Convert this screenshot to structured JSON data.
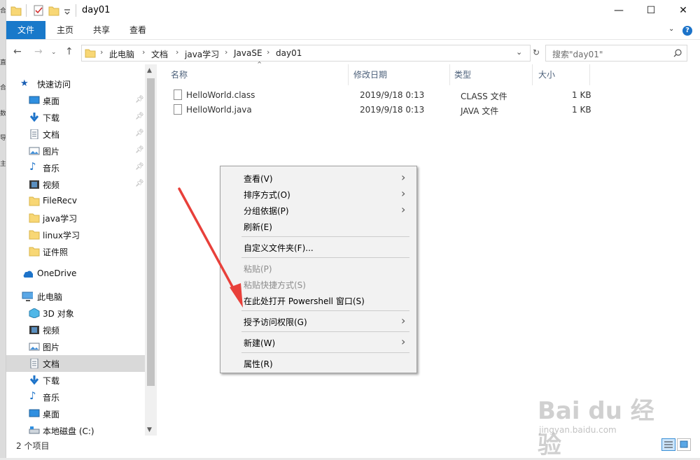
{
  "window": {
    "title": "day01",
    "controls": {
      "minimize": "—",
      "maximize": "☐",
      "close": "✕"
    }
  },
  "ribbon": {
    "tabs": [
      {
        "label": "文件",
        "active": true
      },
      {
        "label": "主页",
        "active": false
      },
      {
        "label": "共享",
        "active": false
      },
      {
        "label": "查看",
        "active": false
      }
    ],
    "expand": "⌄",
    "help": "?"
  },
  "address": {
    "breadcrumb": [
      "此电脑",
      "文档",
      "java学习",
      "JavaSE",
      "day01"
    ],
    "search_placeholder": "搜索\"day01\""
  },
  "sidebar": {
    "quick_access": "快速访问",
    "quick_items": [
      "桌面",
      "下载",
      "文档",
      "图片",
      "音乐",
      "视频",
      "FileRecv",
      "java学习",
      "linux学习",
      "证件照"
    ],
    "onedrive": "OneDrive",
    "this_pc": "此电脑",
    "pc_items": [
      "3D 对象",
      "视频",
      "图片",
      "文档",
      "下载",
      "音乐",
      "桌面",
      "本地磁盘 (C:)"
    ],
    "selected": "文档"
  },
  "file_list": {
    "columns": {
      "name": "名称",
      "modified": "修改日期",
      "type": "类型",
      "size": "大小"
    },
    "rows": [
      {
        "name": "HelloWorld.class",
        "modified": "2019/9/18 0:13",
        "type": "CLASS 文件",
        "size": "1 KB"
      },
      {
        "name": "HelloWorld.java",
        "modified": "2019/9/18 0:13",
        "type": "JAVA 文件",
        "size": "1 KB"
      }
    ]
  },
  "status": {
    "count": "2 个项目"
  },
  "context_menu": {
    "items": [
      {
        "label": "查看(V)",
        "submenu": true,
        "disabled": false
      },
      {
        "label": "排序方式(O)",
        "submenu": true,
        "disabled": false
      },
      {
        "label": "分组依据(P)",
        "submenu": true,
        "disabled": false
      },
      {
        "label": "刷新(E)",
        "submenu": false,
        "disabled": false
      },
      {
        "label": "自定义文件夹(F)...",
        "submenu": false,
        "disabled": false
      },
      {
        "label": "粘贴(P)",
        "submenu": false,
        "disabled": true
      },
      {
        "label": "粘贴快捷方式(S)",
        "submenu": false,
        "disabled": true
      },
      {
        "label": "在此处打开 Powershell 窗口(S)",
        "submenu": false,
        "disabled": false
      },
      {
        "label": "授予访问权限(G)",
        "submenu": true,
        "disabled": false
      },
      {
        "label": "新建(W)",
        "submenu": true,
        "disabled": false
      },
      {
        "label": "属性(R)",
        "submenu": false,
        "disabled": false
      }
    ]
  },
  "watermark": {
    "brand": "Bai du 经验",
    "url": "jingyan.baidu.com"
  },
  "colors": {
    "accent": "#1979ca",
    "annotation_arrow": "#e8403a",
    "selected_bg": "#d9d9d9"
  }
}
